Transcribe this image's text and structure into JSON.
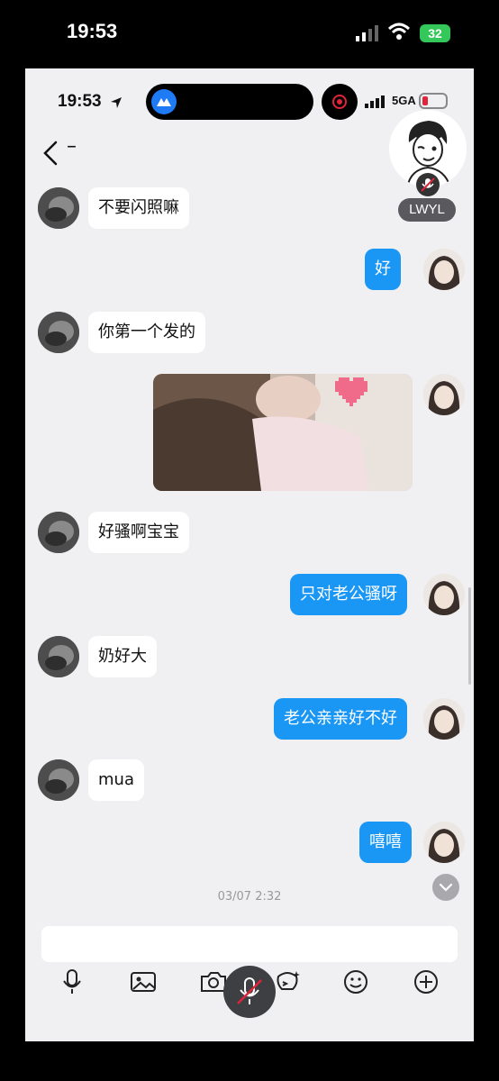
{
  "outer_status": {
    "time": "19:53",
    "battery": "32"
  },
  "inner_status": {
    "time": "19:53",
    "network": "5GA"
  },
  "header": {
    "title": "–"
  },
  "widget": {
    "label": "LWYL"
  },
  "messages": [
    {
      "side": "in",
      "text": "不要闪照嘛"
    },
    {
      "side": "out",
      "text": "好"
    },
    {
      "side": "in",
      "text": "你第一个发的"
    },
    {
      "side": "out",
      "type": "image"
    },
    {
      "side": "in",
      "text": "好骚啊宝宝"
    },
    {
      "side": "out",
      "text": "只对老公骚呀"
    },
    {
      "side": "in",
      "text": "奶好大"
    },
    {
      "side": "out",
      "text": "老公亲亲好不好"
    },
    {
      "side": "in",
      "text": "mua"
    },
    {
      "side": "out",
      "text": "嘻嘻"
    }
  ],
  "timestamp": "03/07 2:32",
  "input": {
    "placeholder": ""
  },
  "toolbar": {
    "icons": [
      "microphone-icon",
      "image-icon",
      "camera-icon",
      "mute-mic-icon",
      "sticker-icon",
      "emoji-icon",
      "plus-icon"
    ]
  },
  "colors": {
    "outgoing_bubble": "#1a96f5",
    "incoming_bubble": "#ffffff",
    "background": "#f0f0f3"
  }
}
